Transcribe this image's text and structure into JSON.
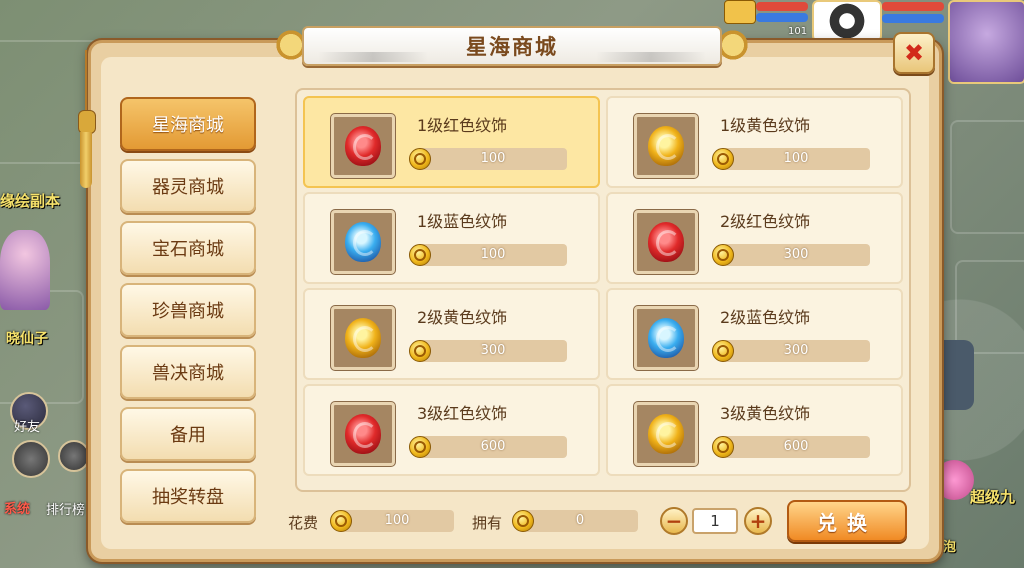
{
  "window": {
    "title": "星海商城",
    "close_label": "✖"
  },
  "tabs": [
    {
      "label": "星海商城",
      "active": true
    },
    {
      "label": "器灵商城",
      "active": false
    },
    {
      "label": "宝石商城",
      "active": false
    },
    {
      "label": "珍兽商城",
      "active": false
    },
    {
      "label": "兽决商城",
      "active": false
    },
    {
      "label": "备用",
      "active": false
    },
    {
      "label": "抽奖转盘",
      "active": false
    }
  ],
  "items": [
    {
      "name": "1级红色纹饰",
      "price": "100",
      "gem": "red",
      "selected": true
    },
    {
      "name": "1级黄色纹饰",
      "price": "100",
      "gem": "yellow",
      "selected": false
    },
    {
      "name": "1级蓝色纹饰",
      "price": "100",
      "gem": "blue",
      "selected": false
    },
    {
      "name": "2级红色纹饰",
      "price": "300",
      "gem": "red",
      "selected": false
    },
    {
      "name": "2级黄色纹饰",
      "price": "300",
      "gem": "yellow",
      "selected": false
    },
    {
      "name": "2级蓝色纹饰",
      "price": "300",
      "gem": "blue",
      "selected": false
    },
    {
      "name": "3级红色纹饰",
      "price": "600",
      "gem": "red",
      "selected": false
    },
    {
      "name": "3级黄色纹饰",
      "price": "600",
      "gem": "yellow",
      "selected": false
    }
  ],
  "footer": {
    "cost_label": "花费",
    "cost_value": "100",
    "own_label": "拥有",
    "own_value": "0",
    "quantity": "1",
    "minus_label": "−",
    "plus_label": "+",
    "exchange_label": "兑换"
  },
  "scene": {
    "left_label_1": "缘绘副本",
    "left_label_2": "晓仙子",
    "friend_label": "好友",
    "system_label": "系统",
    "rank_label": "排行榜",
    "right_label_1": "超级九",
    "right_label_2": "泡泡",
    "top_level": "101"
  },
  "colors": {
    "accent": "#e39a34",
    "close": "#d22a1a",
    "text": "#5a3a1c"
  }
}
